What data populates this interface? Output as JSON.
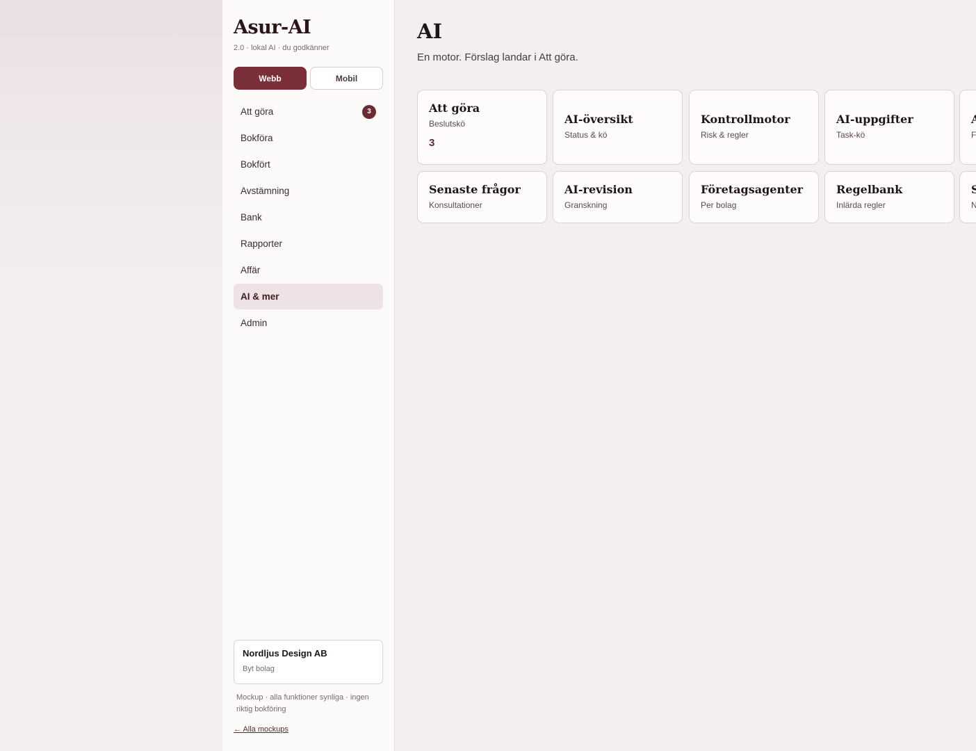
{
  "sidebar": {
    "brand": "Asur-AI",
    "version": "2.0 · lokal AI · du godkänner",
    "view_toggle": {
      "web": "Webb",
      "mobile": "Mobil"
    },
    "nav": [
      {
        "label": "Att göra",
        "badge": "3"
      },
      {
        "label": "Bokföra"
      },
      {
        "label": "Bokfört"
      },
      {
        "label": "Avstämning"
      },
      {
        "label": "Bank"
      },
      {
        "label": "Rapporter"
      },
      {
        "label": "Affär"
      },
      {
        "label": "AI & mer",
        "active": true
      },
      {
        "label": "Admin"
      }
    ],
    "company": {
      "name": "Nordljus Design AB",
      "switch_label": "Byt bolag"
    },
    "note": "Mockup · alla funktioner synliga · ingen riktig bokföring",
    "back_link": "← Alla mockups"
  },
  "main": {
    "title": "AI",
    "subtitle": "En motor. Förslag landar i Att göra.",
    "cards": [
      {
        "title": "Att göra",
        "subtitle": "Beslutskö",
        "count": "3"
      },
      {
        "title": "AI-översikt",
        "subtitle": "Status & kö"
      },
      {
        "title": "Kontrollmotor",
        "subtitle": "Risk & regler"
      },
      {
        "title": "AI-uppgifter",
        "subtitle": "Task-kö"
      },
      {
        "title": "A",
        "subtitle": "F"
      },
      {
        "title": "Senaste frågor",
        "subtitle": "Konsultationer"
      },
      {
        "title": "AI-revision",
        "subtitle": "Granskning"
      },
      {
        "title": "Företagsagenter",
        "subtitle": "Per bolag"
      },
      {
        "title": "Regelbank",
        "subtitle": "Inlärda regler"
      },
      {
        "title": "S",
        "subtitle": "N"
      }
    ]
  },
  "colors": {
    "accent": "#7a2e37",
    "active_nav_bg": "#efe2e4",
    "badge": "#6e2a32"
  }
}
